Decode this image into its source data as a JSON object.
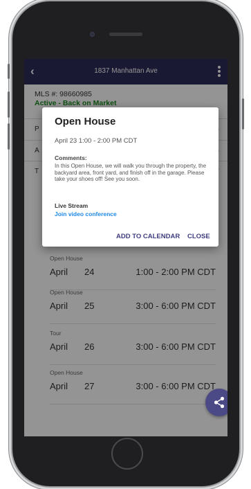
{
  "top_bar": {
    "back_icon": "chevron-left-icon",
    "title": "1837 Manhattan Ave",
    "menu_icon": "more-vertical-icon"
  },
  "listing": {
    "mls": "MLS #: 98660985",
    "status": "Active - Back on Market",
    "status_color": "#1a8a22"
  },
  "sections": [
    {
      "label": "P",
      "icon": "chevron-down-icon"
    },
    {
      "label": "A",
      "icon": "chevron-down-icon"
    },
    {
      "label": "T",
      "icon": "chevron-up-icon"
    }
  ],
  "events": [
    {
      "type": "Open House",
      "month": "April",
      "day": "24",
      "time": "1:00 - 2:00 PM CDT"
    },
    {
      "type": "Open House",
      "month": "April",
      "day": "25",
      "time": "3:00 - 6:00 PM CDT"
    },
    {
      "type": "Tour",
      "month": "April",
      "day": "26",
      "time": "3:00 - 6:00 PM CDT"
    },
    {
      "type": "Open House",
      "month": "April",
      "day": "27",
      "time": "3:00 - 6:00 PM CDT"
    }
  ],
  "fab": {
    "icon": "share-icon",
    "color": "#4b4a86"
  },
  "dialog": {
    "title": "Open House",
    "date": "April 23   1:00 - 2:00 PM CDT",
    "comments_heading": "Comments:",
    "comments": "In this Open House, we will walk you through the property, the backyard area, front yard, and finish off in the garage.  Please take your shoes off!  See you soon.",
    "live_stream_heading": "Live Stream",
    "join_link": "Join video conference",
    "add_to_calendar": "ADD TO CALENDAR",
    "close": "CLOSE"
  },
  "colors": {
    "header": "#2d2b5a",
    "accent": "#3f3d80",
    "link": "#1e88e5"
  }
}
